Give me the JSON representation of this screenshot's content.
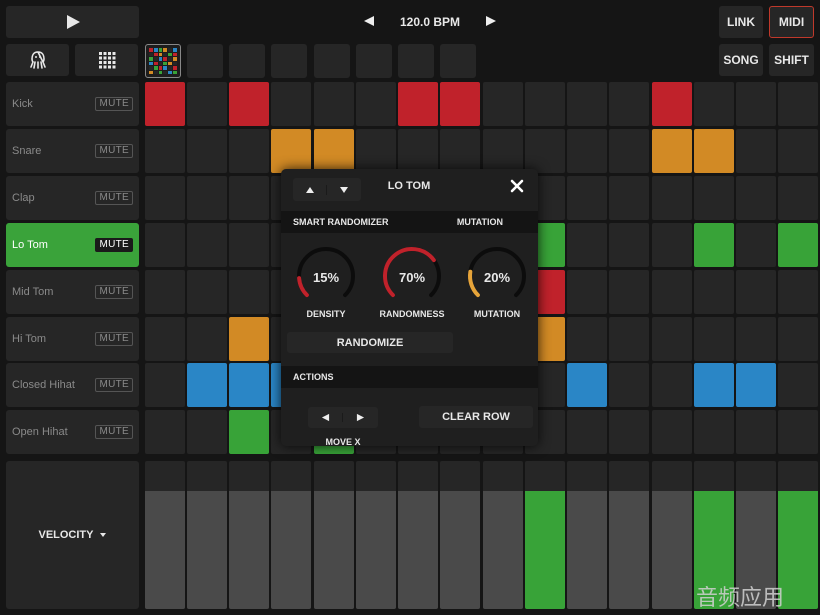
{
  "transport": {
    "play_icon": "play-icon",
    "tempo_label": "120.0 BPM",
    "tempo_down_icon": "left-arrow-icon",
    "tempo_up_icon": "right-arrow-icon"
  },
  "top_right": {
    "link": "LINK",
    "midi": "MIDI",
    "song": "SONG",
    "shift": "SHIFT"
  },
  "tools": {
    "octopus_icon": "octopus-icon",
    "grid_icon": "grid-icon"
  },
  "tracks": [
    {
      "name": "Kick",
      "mute": "MUTE",
      "selected": false
    },
    {
      "name": "Snare",
      "mute": "MUTE",
      "selected": false
    },
    {
      "name": "Clap",
      "mute": "MUTE",
      "selected": false
    },
    {
      "name": "Lo Tom",
      "mute": "MUTE",
      "selected": true
    },
    {
      "name": "Mid Tom",
      "mute": "MUTE",
      "selected": false
    },
    {
      "name": "Hi Tom",
      "mute": "MUTE",
      "selected": false
    },
    {
      "name": "Closed Hihat",
      "mute": "MUTE",
      "selected": false
    },
    {
      "name": "Open Hihat",
      "mute": "MUTE",
      "selected": false
    }
  ],
  "colors": {
    "kick": "#c0222b",
    "snare": "#d28a25",
    "lo_tom": "#38a338",
    "closed_hihat": "#2a86c6",
    "open_hihat": "#38a338",
    "mid_tom": "#c0222b",
    "hi_tom": "#d28a25",
    "accent_midi": "#c0392b",
    "cell": "#262626"
  },
  "steps": {
    "kick": [
      1,
      0,
      1,
      0,
      0,
      0,
      1,
      1,
      0,
      0,
      0,
      0,
      1,
      0,
      0,
      0
    ],
    "snare": [
      0,
      0,
      0,
      1,
      1,
      0,
      0,
      0,
      0,
      0,
      0,
      0,
      1,
      1,
      0,
      0
    ],
    "clap": [
      0,
      0,
      0,
      0,
      0,
      0,
      0,
      0,
      0,
      0,
      0,
      0,
      0,
      0,
      0,
      0
    ],
    "lo_tom": [
      0,
      0,
      0,
      0,
      0,
      0,
      0,
      0,
      0,
      1,
      0,
      0,
      0,
      1,
      0,
      1
    ],
    "mid_tom": [
      0,
      0,
      0,
      0,
      0,
      0,
      0,
      0,
      0,
      1,
      0,
      0,
      0,
      0,
      0,
      0
    ],
    "hi_tom": [
      0,
      0,
      1,
      0,
      0,
      0,
      0,
      0,
      0,
      1,
      0,
      0,
      0,
      0,
      0,
      0
    ],
    "closed_hihat": [
      0,
      1,
      1,
      1,
      0,
      0,
      0,
      0,
      0,
      0,
      1,
      0,
      0,
      1,
      1,
      0
    ],
    "open_hihat": [
      0,
      0,
      1,
      0,
      1,
      0,
      0,
      0,
      0,
      0,
      0,
      0,
      0,
      0,
      0,
      0
    ]
  },
  "velocity": {
    "label": "VELOCITY",
    "dropdown_icon": "triangle-down-icon",
    "levels": [
      0.8,
      0.8,
      0.8,
      0.8,
      0.8,
      0.8,
      0.8,
      0.8,
      0.8,
      0.8,
      0.8,
      0.8,
      0.8,
      0.8,
      0.8,
      0.8
    ],
    "active": [
      0,
      0,
      0,
      0,
      0,
      0,
      0,
      0,
      0,
      1,
      0,
      0,
      0,
      1,
      0,
      1
    ]
  },
  "popup": {
    "title": "LO TOM",
    "up_icon": "triangle-up-icon",
    "down_icon": "triangle-down-icon",
    "close_icon": "close-icon",
    "smart_randomizer_label": "SMART RANDOMIZER",
    "mutation_header": "MUTATION",
    "knobs": [
      {
        "label": "DENSITY",
        "value": "15%",
        "level": 0.15,
        "color": "#c0222b"
      },
      {
        "label": "RANDOMNESS",
        "value": "70%",
        "level": 0.7,
        "color": "#c0222b"
      },
      {
        "label": "MUTATION",
        "value": "20%",
        "level": 0.2,
        "color": "#e6a43a"
      }
    ],
    "randomize": "RANDOMIZE",
    "actions_label": "ACTIONS",
    "move_left_icon": "left-arrow-icon",
    "move_right_icon": "right-arrow-icon",
    "move_label": "MOVE X",
    "clear_row": "CLEAR ROW"
  },
  "watermark": "音频应用"
}
